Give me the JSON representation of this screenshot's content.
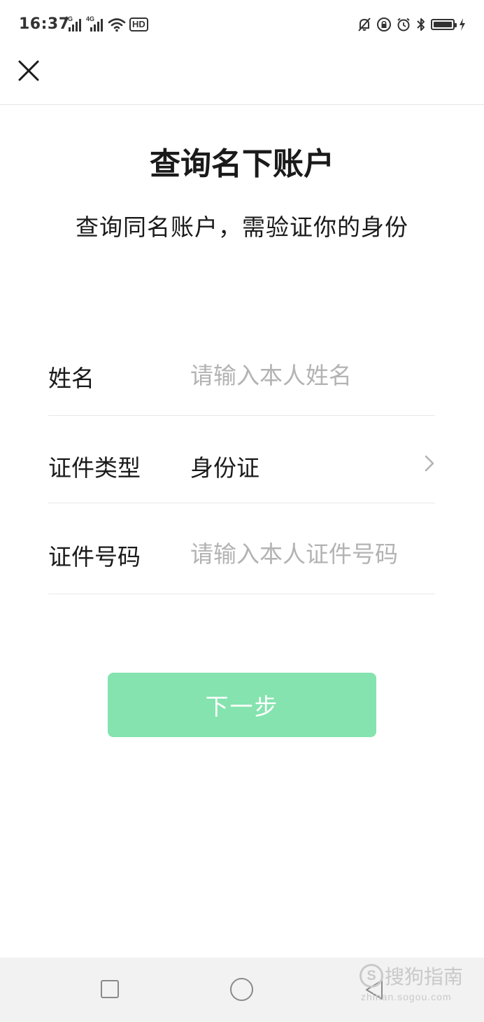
{
  "status_bar": {
    "time": "16:37",
    "network_tag_1": "4G",
    "network_tag_2": "4G",
    "hd_label": "HD"
  },
  "header": {
    "close_icon": "close-icon"
  },
  "page": {
    "title": "查询名下账户",
    "subtitle": "查询同名账户，需验证你的身份"
  },
  "form": {
    "name": {
      "label": "姓名",
      "placeholder": "请输入本人姓名",
      "value": ""
    },
    "id_type": {
      "label": "证件类型",
      "value": "身份证",
      "icon": "chevron-right-icon"
    },
    "id_number": {
      "label": "证件号码",
      "placeholder": "请输入本人证件号码",
      "value": ""
    }
  },
  "actions": {
    "next_label": "下一步"
  },
  "nav_bar": {
    "recent_icon": "square-icon",
    "home_icon": "circle-icon",
    "back_icon": "triangle-back-icon"
  },
  "watermark": {
    "logo_letter": "S",
    "text": "搜狗指南",
    "url": "zhinan.sogou.com"
  },
  "colors": {
    "accent_disabled": "#84e3ae",
    "placeholder": "#b3b3b3",
    "divider": "#e8e8e8"
  }
}
